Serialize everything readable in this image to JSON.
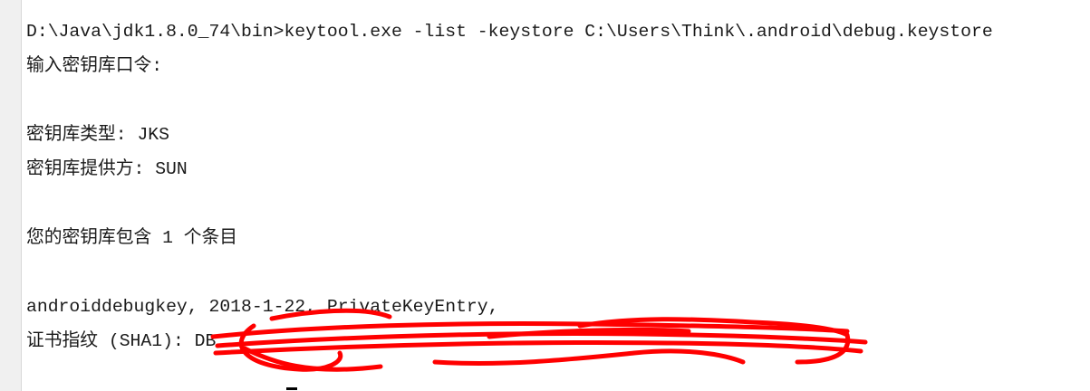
{
  "console": {
    "lines": [
      "D:\\Java\\jdk1.8.0_74\\bin>keytool.exe -list -keystore C:\\Users\\Think\\.android\\debug.keystore",
      "输入密钥库口令:",
      "",
      "密钥库类型: JKS",
      "密钥库提供方: SUN",
      "",
      "您的密钥库包含 1 个条目",
      "",
      "androiddebugkey, 2018-1-22, PrivateKeyEntry,",
      "证书指纹 (SHA1): DB"
    ]
  },
  "colors": {
    "redaction": "#ff0000",
    "text": "#1a1a1a"
  }
}
